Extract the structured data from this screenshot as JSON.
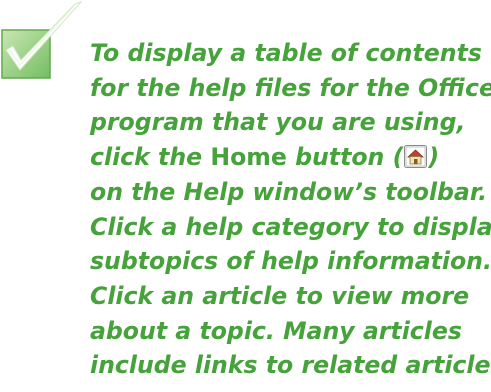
{
  "icons": {
    "tip_icon": "checkbox-check-icon",
    "home_icon": "home-button-icon"
  },
  "colors": {
    "text": "#46a23a",
    "box_fill_top": "#bfe0a6",
    "box_fill_bottom": "#7cc36a",
    "check_mark": "#ffffff"
  },
  "tip": {
    "line1": "To display a table of contents",
    "line2": "for the help files for the Office",
    "line3": "program that you are using,",
    "line4_before": "click the ",
    "line4_home": "Home",
    "line4_after_word": " button (",
    "line4_close": ")",
    "line5": "on the Help window’s toolbar.",
    "line6": "Click a help category to display",
    "line7": "subtopics of help information.",
    "line8": "Click an article to view more",
    "line9": "about a topic. Many articles",
    "line10": "include links to related articles."
  }
}
